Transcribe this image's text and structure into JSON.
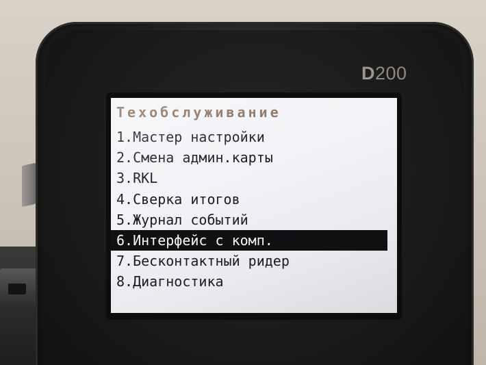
{
  "device": {
    "brand_prefix": "D",
    "brand_model": "200"
  },
  "screen": {
    "title": "Техобслуживание",
    "selected_index": 6,
    "items": [
      {
        "number": "1.",
        "label": "Мастер настройки"
      },
      {
        "number": "2.",
        "label": "Смена админ.карты"
      },
      {
        "number": "3.",
        "label": "RKL"
      },
      {
        "number": "4.",
        "label": "Сверка итогов"
      },
      {
        "number": "5.",
        "label": "Журнал событий"
      },
      {
        "number": "6.",
        "label": "Интерфейс с комп."
      },
      {
        "number": "7.",
        "label": "Бесконтактный ридер"
      },
      {
        "number": "8.",
        "label": "Диагностика"
      }
    ]
  },
  "colors": {
    "title": "#8a6f58",
    "item_text": "#1c1c22",
    "selection_bg": "#111114",
    "selection_text": "#ffffff",
    "screen_bg": "#f3f4f7"
  }
}
